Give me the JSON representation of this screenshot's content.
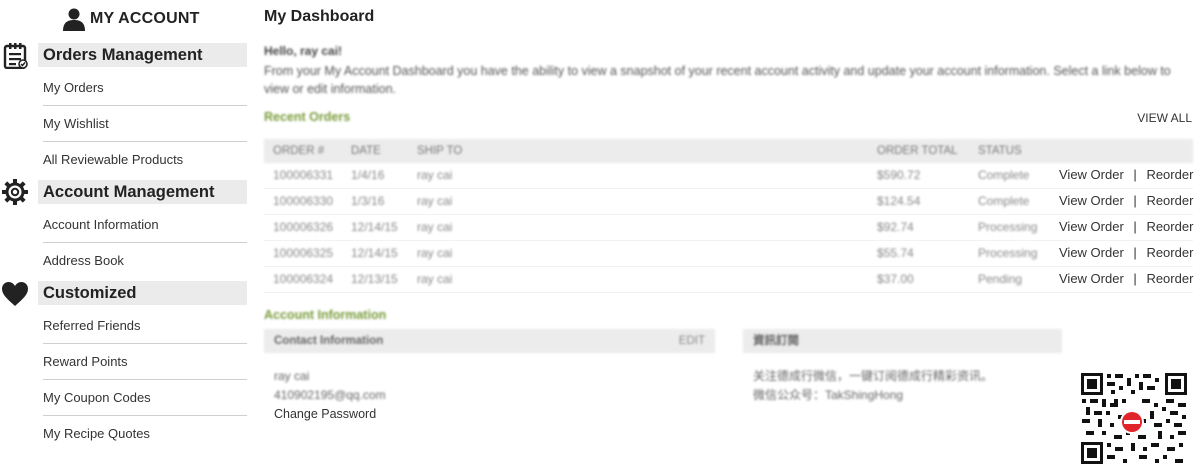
{
  "sidebar": {
    "title": "MY ACCOUNT",
    "sections": [
      {
        "heading": "Orders Management",
        "icon": "clipboard-list-icon",
        "items": [
          "My Orders",
          "My Wishlist",
          "All Reviewable Products"
        ]
      },
      {
        "heading": "Account Management",
        "icon": "gear-icon",
        "items": [
          "Account Information",
          "Address Book"
        ]
      },
      {
        "heading": "Customized",
        "icon": "heart-icon",
        "items": [
          "Referred Friends",
          "Reward Points",
          "My Coupon Codes",
          "My Recipe Quotes"
        ]
      }
    ]
  },
  "main": {
    "title": "My Dashboard",
    "hello": "Hello, ray cai!",
    "intro": "From your My Account Dashboard you have the ability to view a snapshot of your recent account activity and update your account information. Select a link below to view or edit information.",
    "recent_orders_title": "Recent Orders",
    "view_all": "VIEW ALL",
    "orders_columns": [
      "ORDER #",
      "DATE",
      "SHIP TO",
      "ORDER TOTAL",
      "STATUS"
    ],
    "orders": [
      {
        "num": "100006331",
        "date": "1/4/16",
        "ship_to": "ray cai",
        "total": "$590.72",
        "status": "Complete"
      },
      {
        "num": "100006330",
        "date": "1/3/16",
        "ship_to": "ray cai",
        "total": "$124.54",
        "status": "Complete"
      },
      {
        "num": "100006326",
        "date": "12/14/15",
        "ship_to": "ray cai",
        "total": "$92.74",
        "status": "Processing"
      },
      {
        "num": "100006325",
        "date": "12/14/15",
        "ship_to": "ray cai",
        "total": "$55.74",
        "status": "Processing"
      },
      {
        "num": "100006324",
        "date": "12/13/15",
        "ship_to": "ray cai",
        "total": "$37.00",
        "status": "Pending"
      }
    ],
    "view_order_label": "View Order",
    "separator": "|",
    "reorder_label": "Reorder",
    "account_info_title": "Account Information",
    "contact_info_label": "Contact Information",
    "edit_label": "EDIT",
    "contact_name": "ray cai",
    "contact_email": "410902195@qq.com",
    "change_password": "Change Password",
    "newsletter_label": "資訊訂閱",
    "newsletter_line1": "关注德成行微信，一键订阅德成行精彩资讯。",
    "newsletter_line2": "微信公众号：TakShingHong"
  },
  "colors": {
    "section_green": "#7a9c3c",
    "header_bg": "#ebebeb",
    "qr_red": "#e0242a"
  }
}
